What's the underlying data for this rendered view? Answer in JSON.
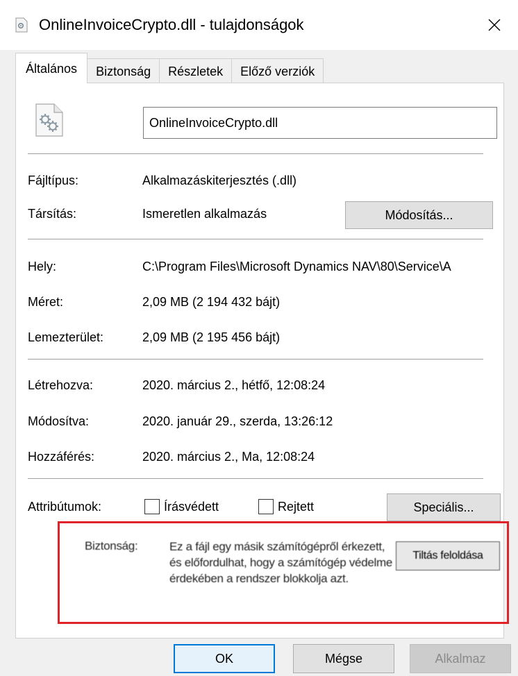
{
  "window": {
    "title": "OnlineInvoiceCrypto.dll - tulajdonságok",
    "close_icon": "close-icon"
  },
  "tabs": [
    {
      "label": "Általános",
      "active": true
    },
    {
      "label": "Biztonság",
      "active": false
    },
    {
      "label": "Részletek",
      "active": false
    },
    {
      "label": "Előző verziók",
      "active": false
    }
  ],
  "general": {
    "file_icon": "dll-gear-file-icon",
    "filename": "OnlineInvoiceCrypto.dll",
    "file_type_label": "Fájltípus:",
    "file_type_value": "Alkalmazáskiterjesztés (.dll)",
    "opens_with_label": "Társítás:",
    "opens_with_value": "Ismeretlen alkalmazás",
    "change_button": "Módosítás...",
    "location_label": "Hely:",
    "location_value": "C:\\Program Files\\Microsoft Dynamics NAV\\80\\Service\\A",
    "size_label": "Méret:",
    "size_value": "2,09 MB (2 194 432 bájt)",
    "size_on_disk_label": "Lemezterület:",
    "size_on_disk_value": "2,09 MB (2 195 456 bájt)",
    "created_label": "Létrehozva:",
    "created_value": "2020. március 2., hétfő, 12:08:24",
    "modified_label": "Módosítva:",
    "modified_value": "2020. január 29., szerda, 13:26:12",
    "accessed_label": "Hozzáférés:",
    "accessed_value": "2020. március 2., Ma, 12:08:24",
    "attributes_label": "Attribútumok:",
    "readonly_label": "Írásvédett",
    "readonly_checked": false,
    "hidden_label": "Rejtett",
    "hidden_checked": false,
    "advanced_button": "Speciális...",
    "security_label": "Biztonság:",
    "security_text": "Ez a fájl egy másik számítógépről érkezett, és előfordulhat, hogy a számítógép védelme érdekében a rendszer blokkolja azt.",
    "unblock_button": "Tiltás feloldása"
  },
  "footer": {
    "ok": "OK",
    "cancel": "Mégse",
    "apply": "Alkalmaz"
  },
  "colors": {
    "highlight_box": "#e0222b",
    "ok_border": "#0078d7"
  }
}
